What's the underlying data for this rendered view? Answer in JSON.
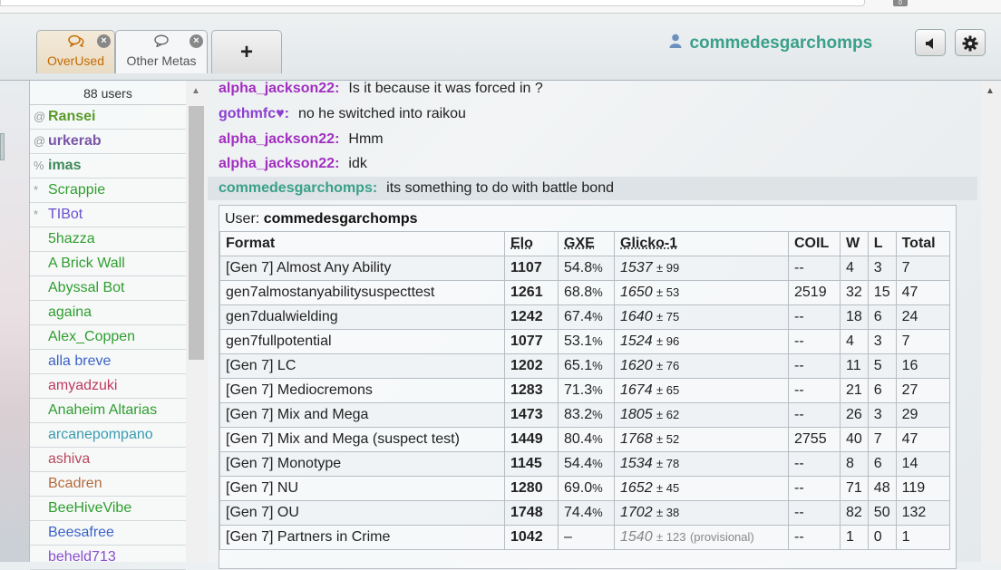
{
  "header": {
    "tabs": [
      {
        "label": "OverUsed",
        "icon": "chat-bubbles-icon"
      },
      {
        "label": "Other Metas",
        "icon": "chat-bubble-icon"
      }
    ],
    "new_tab_label": "+",
    "username": "commedesgarchomps",
    "top_badge": "0",
    "volume_icon": "speaker-icon",
    "settings_icon": "gear-icon"
  },
  "userlist": {
    "count": "88 users",
    "users": [
      {
        "group": "@",
        "name": "Ransei",
        "color": "#5b9a2a",
        "bold": true
      },
      {
        "group": "@",
        "name": "urkerab",
        "color": "#7a55a8",
        "bold": true
      },
      {
        "group": "%",
        "name": "imas",
        "color": "#3f8a5a",
        "bold": true
      },
      {
        "group": "*",
        "name": "Scrappie",
        "color": "#2f9e2f",
        "bold": false
      },
      {
        "group": "*",
        "name": "TIBot",
        "color": "#6a4fd0",
        "bold": false
      },
      {
        "group": "",
        "name": "5hazza",
        "color": "#2f9e2f",
        "bold": false
      },
      {
        "group": "",
        "name": "A Brick Wall",
        "color": "#2f9e2f",
        "bold": false
      },
      {
        "group": "",
        "name": "Abyssal Bot",
        "color": "#2f9e2f",
        "bold": false
      },
      {
        "group": "",
        "name": "againa",
        "color": "#2f9e2f",
        "bold": false
      },
      {
        "group": "",
        "name": "Alex_Coppen",
        "color": "#2f9e2f",
        "bold": false
      },
      {
        "group": "",
        "name": "alla breve",
        "color": "#3c63c7",
        "bold": false
      },
      {
        "group": "",
        "name": "amyadzuki",
        "color": "#c0395e",
        "bold": false
      },
      {
        "group": "",
        "name": "Anaheim Altarias",
        "color": "#2f9e2f",
        "bold": false
      },
      {
        "group": "",
        "name": "arcanepompano",
        "color": "#3a9bb0",
        "bold": false
      },
      {
        "group": "",
        "name": "ashiva",
        "color": "#b8485c",
        "bold": false
      },
      {
        "group": "",
        "name": "Bcadren",
        "color": "#b86a3a",
        "bold": false
      },
      {
        "group": "",
        "name": "BeeHiveVibe",
        "color": "#2f9e2f",
        "bold": false
      },
      {
        "group": "",
        "name": "Beesafree",
        "color": "#3c63c7",
        "bold": false
      },
      {
        "group": "",
        "name": "beheld713",
        "color": "#8a4fd0",
        "bold": false
      }
    ]
  },
  "chat": {
    "messages": [
      {
        "user": "alpha_jackson22:",
        "text": "Is it because it was forced in ?",
        "color": "#a12fc0"
      },
      {
        "user": "gothmfc♥:",
        "text": "no he switched into raikou",
        "color": "#8a3fd0"
      },
      {
        "user": "alpha_jackson22:",
        "text": "Hmm",
        "color": "#a12fc0"
      },
      {
        "user": "alpha_jackson22:",
        "text": "idk",
        "color": "#a12fc0"
      },
      {
        "user": "commedesgarchomps:",
        "text": "its something to do with battle bond",
        "color": "#3aa08a"
      }
    ]
  },
  "ranking": {
    "user_label": "User:",
    "user": "commedesgarchomps",
    "headers": [
      "Format",
      "Elo",
      "GXE",
      "Glicko-1",
      "COIL",
      "W",
      "L",
      "Total"
    ],
    "rows": [
      {
        "format": "[Gen 7] Almost Any Ability",
        "elo": "1107",
        "gxe": "54.8",
        "gxe_unit": "%",
        "glicko": "1537",
        "dev": "± 99",
        "prov": "",
        "coil": "--",
        "w": "4",
        "l": "3",
        "total": "7"
      },
      {
        "format": "gen7almostanyabilitysuspecttest",
        "elo": "1261",
        "gxe": "68.8",
        "gxe_unit": "%",
        "glicko": "1650",
        "dev": "± 53",
        "prov": "",
        "coil": "2519",
        "w": "32",
        "l": "15",
        "total": "47"
      },
      {
        "format": "gen7dualwielding",
        "elo": "1242",
        "gxe": "67.4",
        "gxe_unit": "%",
        "glicko": "1640",
        "dev": "± 75",
        "prov": "",
        "coil": "--",
        "w": "18",
        "l": "6",
        "total": "24"
      },
      {
        "format": "gen7fullpotential",
        "elo": "1077",
        "gxe": "53.1",
        "gxe_unit": "%",
        "glicko": "1524",
        "dev": "± 96",
        "prov": "",
        "coil": "--",
        "w": "4",
        "l": "3",
        "total": "7"
      },
      {
        "format": "[Gen 7] LC",
        "elo": "1202",
        "gxe": "65.1",
        "gxe_unit": "%",
        "glicko": "1620",
        "dev": "± 76",
        "prov": "",
        "coil": "--",
        "w": "11",
        "l": "5",
        "total": "16"
      },
      {
        "format": "[Gen 7] Mediocremons",
        "elo": "1283",
        "gxe": "71.3",
        "gxe_unit": "%",
        "glicko": "1674",
        "dev": "± 65",
        "prov": "",
        "coil": "--",
        "w": "21",
        "l": "6",
        "total": "27"
      },
      {
        "format": "[Gen 7] Mix and Mega",
        "elo": "1473",
        "gxe": "83.2",
        "gxe_unit": "%",
        "glicko": "1805",
        "dev": "± 62",
        "prov": "",
        "coil": "--",
        "w": "26",
        "l": "3",
        "total": "29"
      },
      {
        "format": "[Gen 7] Mix and Mega (suspect test)",
        "elo": "1449",
        "gxe": "80.4",
        "gxe_unit": "%",
        "glicko": "1768",
        "dev": "± 52",
        "prov": "",
        "coil": "2755",
        "w": "40",
        "l": "7",
        "total": "47"
      },
      {
        "format": "[Gen 7] Monotype",
        "elo": "1145",
        "gxe": "54.4",
        "gxe_unit": "%",
        "glicko": "1534",
        "dev": "± 78",
        "prov": "",
        "coil": "--",
        "w": "8",
        "l": "6",
        "total": "14"
      },
      {
        "format": "[Gen 7] NU",
        "elo": "1280",
        "gxe": "69.0",
        "gxe_unit": "%",
        "glicko": "1652",
        "dev": "± 45",
        "prov": "",
        "coil": "--",
        "w": "71",
        "l": "48",
        "total": "119"
      },
      {
        "format": "[Gen 7] OU",
        "elo": "1748",
        "gxe": "74.4",
        "gxe_unit": "%",
        "glicko": "1702",
        "dev": "± 38",
        "prov": "",
        "coil": "--",
        "w": "82",
        "l": "50",
        "total": "132"
      },
      {
        "format": "[Gen 7] Partners in Crime",
        "elo": "1042",
        "gxe": "–",
        "gxe_unit": "",
        "glicko": "1540",
        "dev": "± 123",
        "prov": "(provisional)",
        "coil": "--",
        "w": "1",
        "l": "0",
        "total": "1"
      }
    ]
  }
}
